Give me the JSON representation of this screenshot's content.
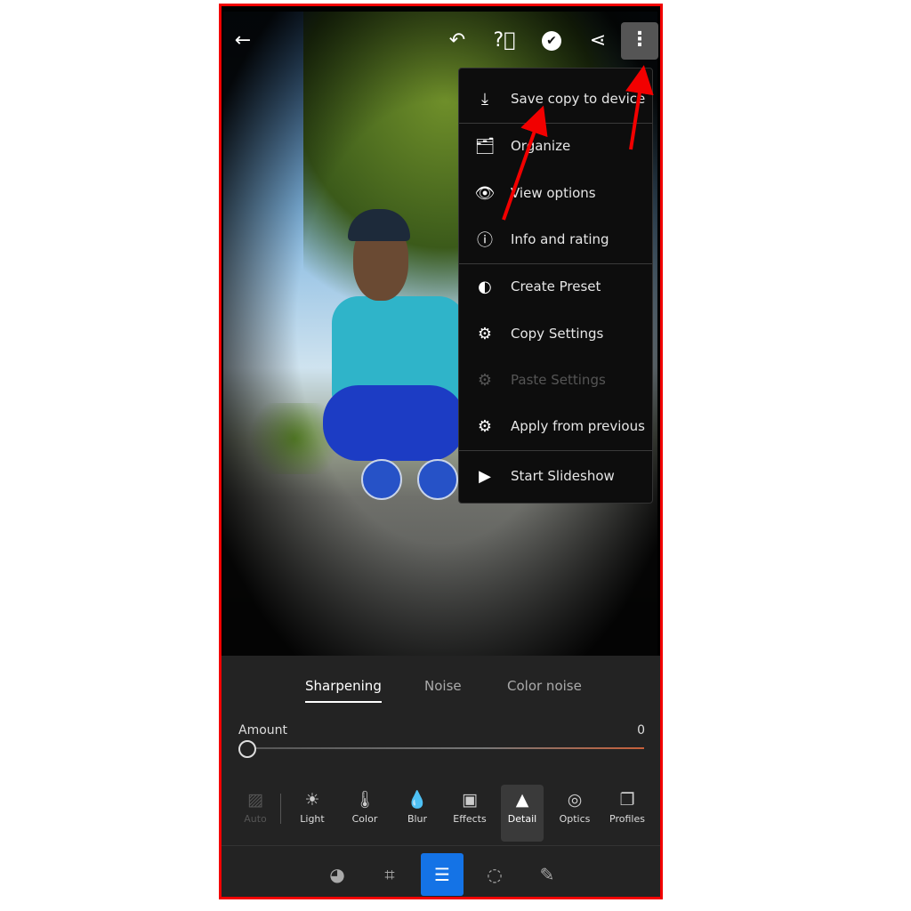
{
  "topbar": {
    "back": "back-arrow-icon",
    "undo": "undo-icon",
    "help": "help-icon",
    "done": "checkmark-icon",
    "share": "share-icon",
    "more": "more-vertical-icon"
  },
  "menu": {
    "items": [
      {
        "label": "Save copy to device",
        "icon": "⤓",
        "enabled": true
      },
      {
        "label": "Organize",
        "icon": "🗂",
        "enabled": true
      },
      {
        "label": "View options",
        "icon": "👁",
        "enabled": true
      },
      {
        "label": "Info and rating",
        "icon": "ⓘ",
        "enabled": true
      },
      {
        "label": "Create Preset",
        "icon": "◐",
        "enabled": true
      },
      {
        "label": "Copy Settings",
        "icon": "⚙",
        "enabled": true
      },
      {
        "label": "Paste Settings",
        "icon": "⚙",
        "enabled": false
      },
      {
        "label": "Apply from previous",
        "icon": "⚙",
        "enabled": true
      },
      {
        "label": "Start Slideshow",
        "icon": "▶",
        "enabled": true
      }
    ]
  },
  "detail": {
    "tabs": [
      "Sharpening",
      "Noise",
      "Color noise"
    ],
    "active_tab": "Sharpening",
    "slider_label": "Amount",
    "slider_value": "0"
  },
  "tools": [
    {
      "label": "Auto",
      "icon": "▨"
    },
    {
      "label": "Light",
      "icon": "☀"
    },
    {
      "label": "Color",
      "icon": "🌡"
    },
    {
      "label": "Blur",
      "icon": "💧"
    },
    {
      "label": "Effects",
      "icon": "▣"
    },
    {
      "label": "Detail",
      "icon": "▲"
    },
    {
      "label": "Optics",
      "icon": "◎"
    },
    {
      "label": "Profiles",
      "icon": "❐"
    }
  ],
  "active_tool": "Detail",
  "bottom_tools": [
    "presets-icon",
    "crop-icon",
    "edit-sliders-icon",
    "masking-icon",
    "healing-icon"
  ],
  "colors": {
    "accent": "#1473e6",
    "annotation": "#f20000"
  }
}
